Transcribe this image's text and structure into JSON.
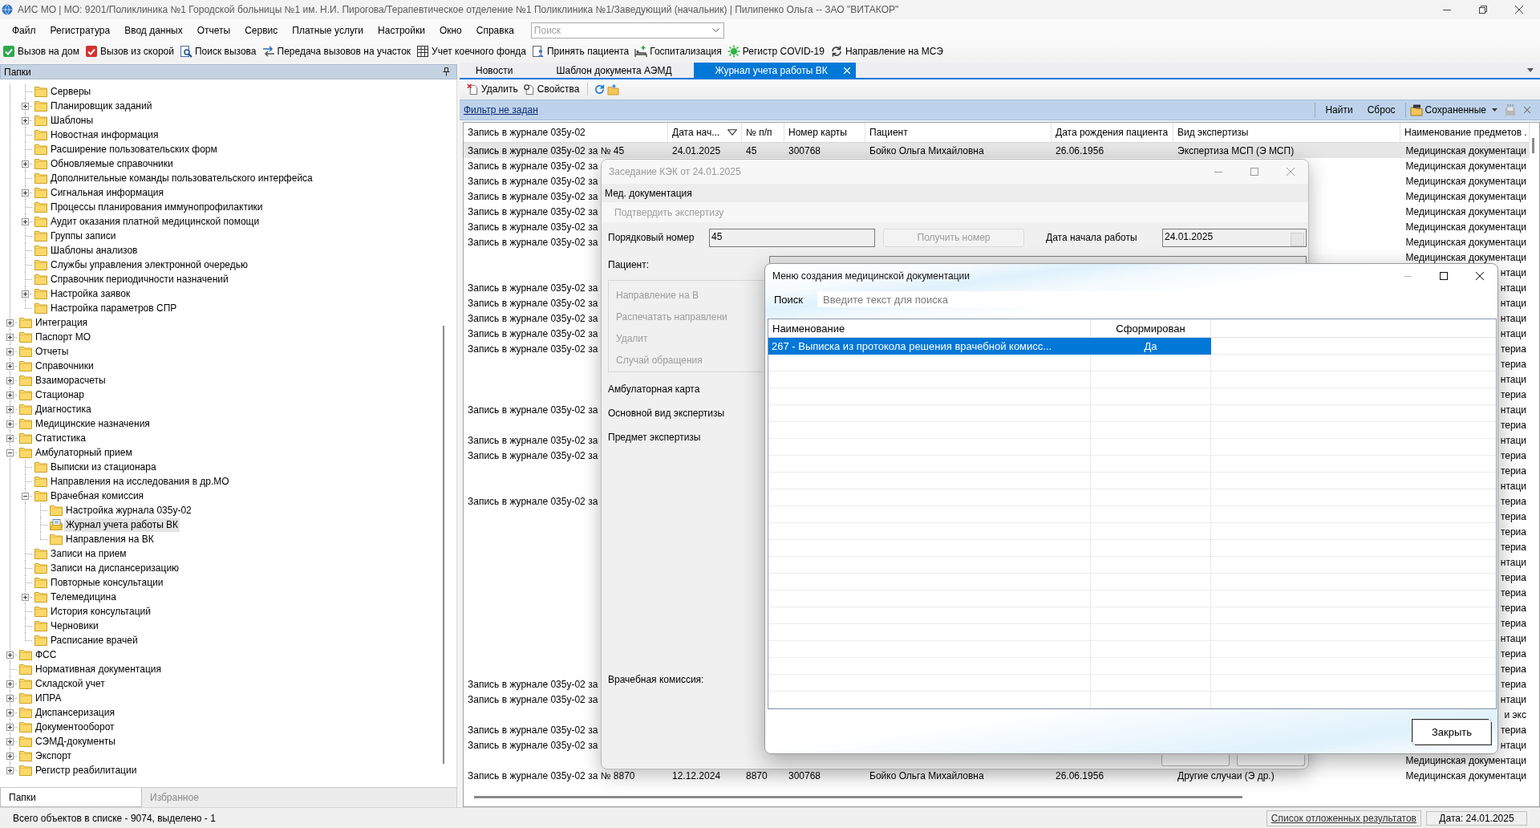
{
  "window": {
    "title": "АИС МО | МО: 9201/Поликлиника №1 Городской больницы №1 им. Н.И. Пирогова/Терапевтическое отделение №1 Поликлиника №1/Заведующий (начальник) | Пилипенко Ольга -- ЗАО \"ВИТАКОР\""
  },
  "menu": [
    "Файл",
    "Регистратура",
    "Ввод данных",
    "Отчеты",
    "Сервис",
    "Платные услуги",
    "Настройки",
    "Окно",
    "Справка"
  ],
  "menu_search": {
    "placeholder": "Поиск"
  },
  "toolbar": [
    "Вызов на дом",
    "Вызов из скорой",
    "Поиск вызова",
    "Передача вызовов на участок",
    "Учет коечного фонда",
    "Принять пациента",
    "Госпитализация",
    "Регистр COVID-19",
    "Направление на МСЭ"
  ],
  "folders_panel": {
    "title": "Папки",
    "tree": {
      "children_of_scrolled_parent": [
        {
          "label": "Серверы",
          "has_children": false,
          "expanded": false,
          "selected": false
        },
        {
          "label": "Планировщик заданий",
          "has_children": true,
          "expanded": false,
          "selected": false
        },
        {
          "label": "Шаблоны",
          "has_children": true,
          "expanded": false,
          "selected": false
        },
        {
          "label": "Новостная информация",
          "has_children": false,
          "expanded": false,
          "selected": false
        },
        {
          "label": "Расширение пользовательских форм",
          "has_children": false,
          "expanded": false,
          "selected": false
        },
        {
          "label": "Обновляемые справочники",
          "has_children": true,
          "expanded": false,
          "selected": false
        },
        {
          "label": "Дополнительные команды пользовательского интерфейса",
          "has_children": false,
          "expanded": false,
          "selected": false
        },
        {
          "label": "Сигнальная информация",
          "has_children": true,
          "expanded": false,
          "selected": false
        },
        {
          "label": "Процессы планирования иммунопрофилактики",
          "has_children": false,
          "expanded": false,
          "selected": false
        },
        {
          "label": "Аудит оказания платной медицинской помощи",
          "has_children": true,
          "expanded": false,
          "selected": false
        },
        {
          "label": "Группы записи",
          "has_children": false,
          "expanded": false,
          "selected": false
        },
        {
          "label": "Шаблоны анализов",
          "has_children": false,
          "expanded": false,
          "selected": false
        },
        {
          "label": "Службы управления электронной очередью",
          "has_children": false,
          "expanded": false,
          "selected": false
        },
        {
          "label": "Справочник периодичности назначений",
          "has_children": false,
          "expanded": false,
          "selected": false
        },
        {
          "label": "Настройка заявок",
          "has_children": true,
          "expanded": false,
          "selected": false
        },
        {
          "label": "Настройка параметров СПР",
          "has_children": false,
          "expanded": false,
          "selected": false
        }
      ],
      "items": [
        {
          "label": "Интеграция",
          "has_children": true,
          "expanded": false,
          "selected": false
        },
        {
          "label": "Паспорт МО",
          "has_children": true,
          "expanded": false,
          "selected": false
        },
        {
          "label": "Отчеты",
          "has_children": true,
          "expanded": false,
          "selected": false
        },
        {
          "label": "Справочники",
          "has_children": true,
          "expanded": false,
          "selected": false
        },
        {
          "label": "Взаиморасчеты",
          "has_children": true,
          "expanded": false,
          "selected": false
        },
        {
          "label": "Стационар",
          "has_children": true,
          "expanded": false,
          "selected": false
        },
        {
          "label": "Диагностика",
          "has_children": true,
          "expanded": false,
          "selected": false
        },
        {
          "label": "Медицинские назначения",
          "has_children": true,
          "expanded": false,
          "selected": false
        },
        {
          "label": "Статистика",
          "has_children": true,
          "expanded": false,
          "selected": false
        },
        {
          "label": "Амбулаторный прием",
          "has_children": true,
          "expanded": true,
          "selected": false,
          "children": [
            {
              "label": "Выписки из стационара",
              "has_children": false,
              "expanded": false,
              "selected": false
            },
            {
              "label": "Направления на исследования в др.МО",
              "has_children": false,
              "expanded": false,
              "selected": false
            },
            {
              "label": "Врачебная комиссия",
              "has_children": true,
              "expanded": true,
              "selected": false,
              "children": [
                {
                  "label": "Настройка журнала 035у-02",
                  "has_children": false,
                  "expanded": false,
                  "selected": false
                },
                {
                  "label": "Журнал учета работы ВК",
                  "has_children": false,
                  "expanded": false,
                  "selected": true
                },
                {
                  "label": "Направления на ВК",
                  "has_children": false,
                  "expanded": false,
                  "selected": false
                }
              ]
            },
            {
              "label": "Записи на прием",
              "has_children": false,
              "expanded": false,
              "selected": false
            },
            {
              "label": "Записи на диспансеризацию",
              "has_children": false,
              "expanded": false,
              "selected": false
            },
            {
              "label": "Повторные консультации",
              "has_children": false,
              "expanded": false,
              "selected": false
            },
            {
              "label": "Телемедицина",
              "has_children": true,
              "expanded": false,
              "selected": false
            },
            {
              "label": "История консультаций",
              "has_children": false,
              "expanded": false,
              "selected": false
            },
            {
              "label": "Черновики",
              "has_children": false,
              "expanded": false,
              "selected": false
            },
            {
              "label": "Расписание врачей",
              "has_children": false,
              "expanded": false,
              "selected": false
            }
          ]
        },
        {
          "label": "ФСС",
          "has_children": true,
          "expanded": false,
          "selected": false
        },
        {
          "label": "Нормативная документация",
          "has_children": false,
          "expanded": false,
          "selected": false
        },
        {
          "label": "Складской учет",
          "has_children": true,
          "expanded": false,
          "selected": false
        },
        {
          "label": "ИПРА",
          "has_children": true,
          "expanded": false,
          "selected": false
        },
        {
          "label": "Диспансеризация",
          "has_children": true,
          "expanded": false,
          "selected": false
        },
        {
          "label": "Документооборот",
          "has_children": true,
          "expanded": false,
          "selected": false
        },
        {
          "label": "СЭМД-документы",
          "has_children": true,
          "expanded": false,
          "selected": false
        },
        {
          "label": "Экспорт",
          "has_children": true,
          "expanded": false,
          "selected": false
        },
        {
          "label": "Регистр реабилитации",
          "has_children": true,
          "expanded": false,
          "selected": false
        }
      ]
    },
    "tabs": [
      {
        "label": "Папки",
        "selected": true
      },
      {
        "label": "Избранное",
        "selected": false
      }
    ]
  },
  "document_tabs": [
    {
      "label": "Новости",
      "selected": false
    },
    {
      "label": "Шаблон документа АЭМД",
      "selected": false
    },
    {
      "label": "Журнал учета работы ВК",
      "selected": true
    }
  ],
  "journal": {
    "actions": [
      "Удалить",
      "Свойства"
    ],
    "filter": {
      "status_link": "Фильтр не задан",
      "find": "Найти",
      "reset": "Сброс",
      "saved": "Сохраненные"
    },
    "table": {
      "columns": [
        {
          "label": "Запись в журнале 035у-02"
        },
        {
          "label": "Дата нач...",
          "sort_descending": true
        },
        {
          "label": "№ п/п"
        },
        {
          "label": "Номер карты"
        },
        {
          "label": "Пациент"
        },
        {
          "label": "Дата рождения пациента"
        },
        {
          "label": "Вид экспертизы"
        },
        {
          "label": "Наименование предметов ."
        }
      ],
      "rows": [
        {
          "record": "Запись в журнале 035у-02 за № 45",
          "start_date": "24.01.2025",
          "number": "45",
          "card": "300768",
          "patient": "Бойко Ольга Михайловна",
          "birth_date": "26.06.1956",
          "expertise": "Экспертиза МСП (Э МСП)",
          "subjects": "Медицинская документаци",
          "selected": true
        },
        {
          "record": "Запись в журнале 035у-02 за",
          "subjects": "Медицинская документаци",
          "selected": false
        },
        {
          "record": "Запись в журнале 035у-02 за",
          "subjects": "Медицинская документаци",
          "selected": false
        },
        {
          "record": "Запись в журнале 035у-02 за",
          "subjects": "Медицинская документаци",
          "selected": false
        },
        {
          "record": "Запись в журнале 035у-02 за",
          "subjects": "Медицинская документаци",
          "selected": false
        },
        {
          "record": "Запись в журнале 035у-02 за",
          "subjects": "Медицинская документаци",
          "selected": false
        },
        {
          "record": "Запись в журнале 035у-02 за",
          "subjects": "Медицинская документаци",
          "selected": false
        },
        {
          "subjects": "Медицинская документаци",
          "selected": false
        },
        {
          "subjects": "нтаци",
          "selected": false
        },
        {
          "record": "Запись в журнале 035у-02 за",
          "subjects": "нтаци",
          "selected": false
        },
        {
          "record": "Запись в журнале 035у-02 за",
          "subjects": "нтаци",
          "selected": false
        },
        {
          "record": "Запись в журнале 035у-02 за",
          "subjects": "нтаци",
          "selected": false
        },
        {
          "record": "Запись в журнале 035у-02 за",
          "subjects": "нтаци",
          "selected": false
        },
        {
          "record": "Запись в журнале 035у-02 за",
          "subjects": "териа",
          "selected": false
        },
        {
          "subjects": "териа",
          "selected": false
        },
        {
          "subjects": "нтаци",
          "selected": false
        },
        {
          "subjects": "териа",
          "selected": false
        },
        {
          "record": "Запись в журнале 035у-02 за",
          "subjects": "нтаци",
          "selected": false
        },
        {
          "subjects": "териа",
          "selected": false
        },
        {
          "record": "Запись в журнале 035у-02 за",
          "subjects": "нтаци",
          "selected": false
        },
        {
          "record": "Запись в журнале 035у-02 за",
          "subjects": "териа",
          "selected": false
        },
        {
          "subjects": "териа",
          "selected": false
        },
        {
          "subjects": "нтаци",
          "selected": false
        },
        {
          "record": "Запись в журнале 035у-02 за",
          "subjects": "териа",
          "selected": false
        },
        {
          "subjects": "териа",
          "selected": false
        },
        {
          "subjects": "териа",
          "selected": false
        },
        {
          "subjects": "териа",
          "selected": false
        },
        {
          "subjects": "нтаци",
          "selected": false
        },
        {
          "subjects": "териа",
          "selected": false
        },
        {
          "subjects": "териа",
          "selected": false
        },
        {
          "subjects": "териа",
          "selected": false
        },
        {
          "subjects": "териа",
          "selected": false
        },
        {
          "subjects": "нтаци",
          "selected": false
        },
        {
          "subjects": "териа",
          "selected": false
        },
        {
          "subjects": "териа",
          "selected": false
        },
        {
          "record": "Запись в журнале 035у-02 за",
          "subjects": "териа",
          "selected": false
        },
        {
          "record": "Запись в журнале 035у-02 за",
          "subjects": "нтаци",
          "selected": false
        },
        {
          "subjects": "и экс",
          "selected": false
        },
        {
          "record": "Запись в журнале 035у-02 за",
          "subjects": "териа",
          "selected": false
        },
        {
          "record": "Запись в журнале 035у-02 за",
          "subjects": "нтаци",
          "selected": false
        },
        {
          "subjects": "Медицинская документаци",
          "selected": false
        },
        {
          "record": "Запись в журнале 035у-02 за № 8870",
          "start_date": "12.12.2024",
          "number": "8870",
          "card": "300768",
          "patient": "Бойко Ольга Михайловна",
          "birth_date": "26.06.1956",
          "expertise": "Другие случаи (Э др.)",
          "subjects": "Медицинская документаци",
          "selected": false
        }
      ]
    }
  },
  "status_bar": {
    "summary": "Всего объектов в списке - 9074, выделено - 1",
    "deferred_link": "Список отложенных результатов",
    "date": "Дата: 24.01.2025"
  },
  "kek_dialog": {
    "title": "Заседание КЭК от 24.01.2025",
    "active": false,
    "menu": "Мед. документация",
    "toolbar": {
      "label": "Подтвердить экспертизу",
      "disabled": true
    },
    "number_label": "Порядковый номер",
    "number_value": "45",
    "get_number_button": {
      "label": "Получить номер",
      "disabled": true
    },
    "start_date_label": "Дата начала работы",
    "start_date_value": "24.01.2025",
    "patient_label": "Пациент:",
    "patient_actions": [
      {
        "label": "Направление на В",
        "disabled": true
      },
      {
        "label": "Распечатать направлени",
        "disabled": true
      },
      {
        "label": "Удалит",
        "disabled": true
      },
      {
        "label": "Случай обращения",
        "disabled": true
      }
    ],
    "labels": [
      "Амбулаторная карта",
      "Основной вид экспертизы",
      "Предмет экспертизы"
    ],
    "commission_label": "Врачебная комиссия:"
  },
  "docs_dialog": {
    "title": "Меню создания медицинской документации",
    "active": true,
    "search_label": "Поиск",
    "search_placeholder": "Введите текст для поиска",
    "columns": [
      "Наименование",
      "Сформирован"
    ],
    "rows": [
      {
        "name": "267 - Выписка из протокола решения врачебной комисс...",
        "formed": "Да",
        "selected": true
      }
    ],
    "close_button": "Закрыть"
  }
}
